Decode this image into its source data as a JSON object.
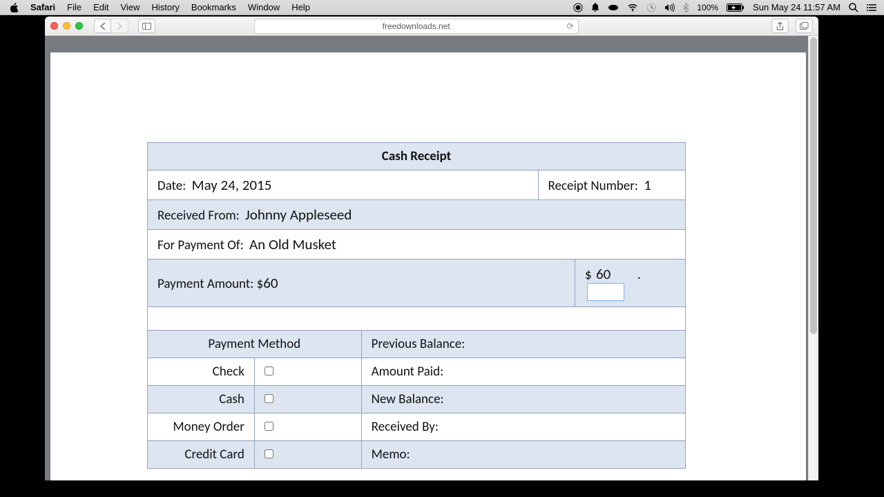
{
  "menubar": {
    "app": "Safari",
    "items": [
      "File",
      "Edit",
      "View",
      "History",
      "Bookmarks",
      "Window",
      "Help"
    ],
    "battery": "100%",
    "clock": "Sun May 24  11:57 AM"
  },
  "browser": {
    "url": "freedownloads.net"
  },
  "receipt": {
    "title": "Cash Receipt",
    "date_label": "Date:",
    "date_value": "May 24, 2015",
    "receipt_no_label": "Receipt Number:",
    "receipt_no_value": "1",
    "from_label": "Received From:",
    "from_value": "Johnny Appleseed",
    "for_label": "For Payment Of:",
    "for_value": "An Old Musket",
    "amount_label": "Payment Amount: $",
    "amount_value": "60",
    "amount_dollar2": "$",
    "amount_value2": "60",
    "amount_dot": ".",
    "pm_header": "Payment Method",
    "pm": {
      "check": "Check",
      "cash": "Cash",
      "money_order": "Money Order",
      "credit": "Credit Card"
    },
    "right": {
      "prev": "Previous Balance:",
      "paid": "Amount Paid:",
      "newbal": "New Balance:",
      "received": "Received By:",
      "memo": "Memo:"
    }
  }
}
